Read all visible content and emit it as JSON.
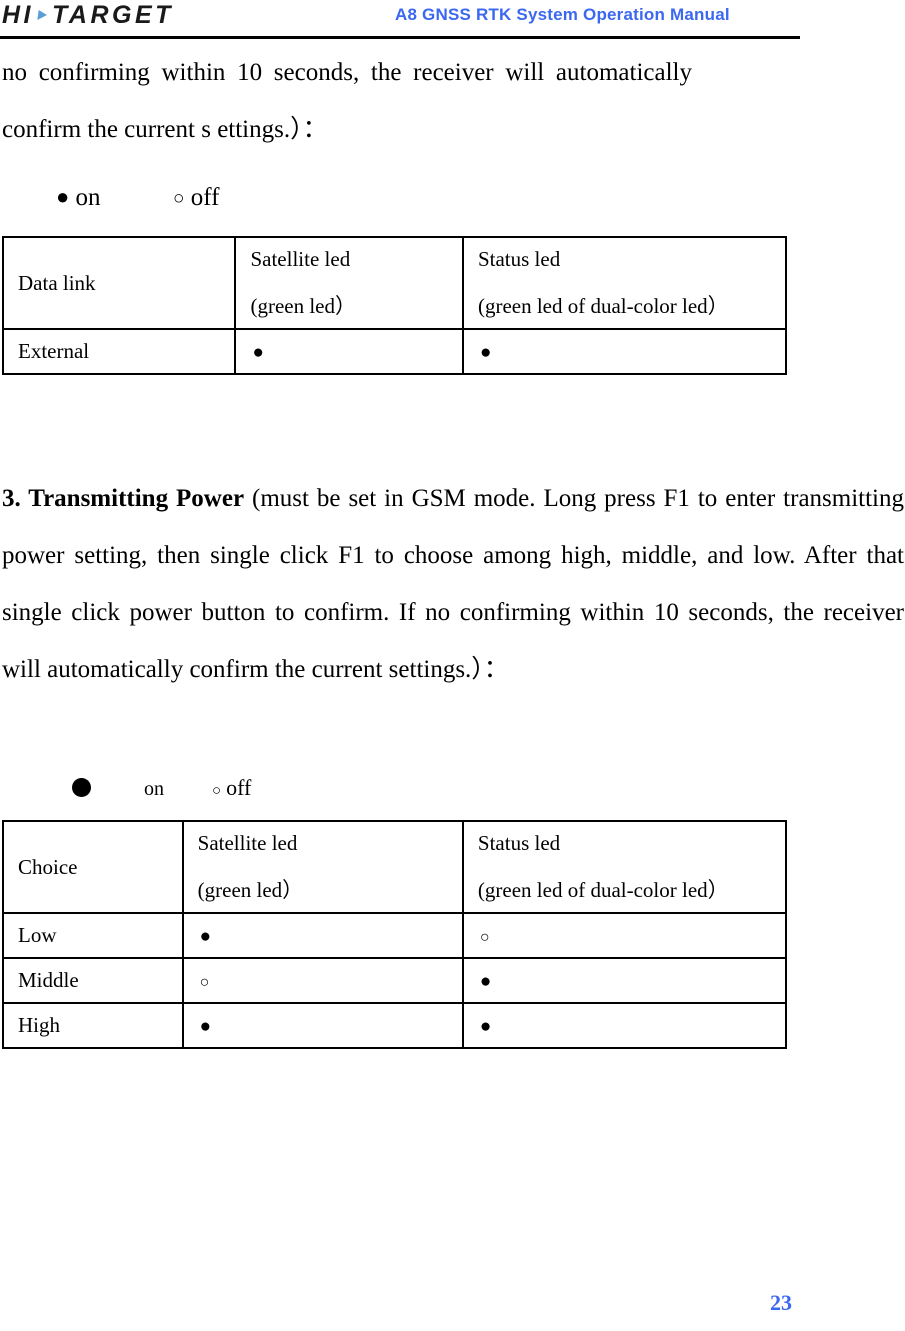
{
  "header": {
    "logo_hi": "HI",
    "logo_mark": "blue-arrow-mark",
    "logo_target": "TARGET",
    "manual_title": "A8  GNSS RTK System Operation Manual"
  },
  "paragraphs": {
    "p1_text": "no confirming within 10 seconds, the receiver will automatically confirm the current s ettings.）：",
    "p2_heading": "3. Transmitting Power",
    "p2_body": " (must be set in GSM mode. Long press F1 to enter transmitting power setting, then single click F1 to choose among high, middle, and low. After that single click power button to confirm. If no confirming within 10 seconds, the receiver will automatically confirm the current settings.）："
  },
  "legend_1": {
    "on_glyph": "●",
    "on_label": "on",
    "off_glyph": "○",
    "off_label": "off"
  },
  "legend_2": {
    "on_glyph": "●",
    "on_label": "on",
    "off_glyph": "○",
    "off_label": "off"
  },
  "table_datalink": {
    "header": {
      "row_label": "Data link",
      "col2_line1": "Satellite led",
      "col2_line2": "(green led）",
      "col3_line1": "Status led",
      "col3_line2": "(green led of dual-color led）"
    },
    "rows": [
      {
        "label": "External",
        "satellite": "●",
        "status": "●"
      }
    ]
  },
  "table_choice": {
    "header": {
      "row_label": "Choice",
      "col2_line1": "Satellite led",
      "col2_line2": "(green led）",
      "col3_line1": "Status led",
      "col3_line2": "(green led of dual-color led）"
    },
    "rows": [
      {
        "label": "Low",
        "satellite": "●",
        "status": "○"
      },
      {
        "label": "Middle",
        "satellite": "○",
        "status": "●"
      },
      {
        "label": "High",
        "satellite": "●",
        "status": "●"
      }
    ]
  },
  "footer": {
    "page_number": "23"
  },
  "colors": {
    "accent_blue": "#3b68f0",
    "logo_mark_blue": "#5b9ed6",
    "text_black": "#000000"
  }
}
